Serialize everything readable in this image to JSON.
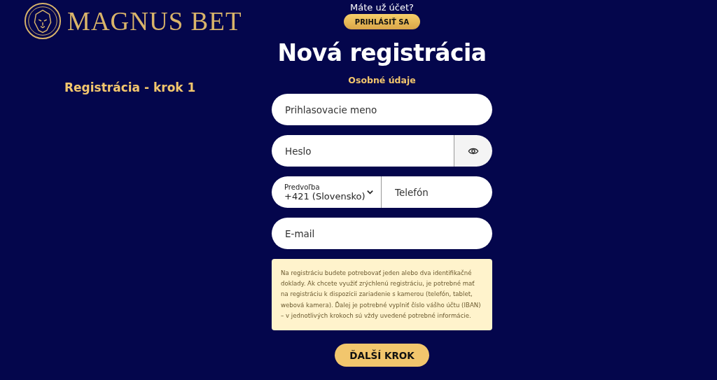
{
  "logo": {
    "text": "MAGNUS BET"
  },
  "step_label": "Registrácia - krok 1",
  "login_prompt": {
    "text": "Máte už účet?",
    "button": "PRIHLÁSIŤ SA"
  },
  "title": "Nová registrácia",
  "section": "Osobné údaje",
  "fields": [
    {
      "kind": "text",
      "placeholder": "Prihlasovacie meno"
    },
    {
      "kind": "password",
      "placeholder": "Heslo"
    },
    {
      "kind": "phone",
      "prefix_label": "Predvoľba",
      "prefix_value": "+421 (Slovensko)",
      "placeholder": "Telefón"
    },
    {
      "kind": "text",
      "placeholder": "E-mail"
    }
  ],
  "info": "Na registráciu budete potrebovať jeden alebo dva identifikačné doklady. Ak chcete využiť zrýchlenú registráciu, je potrebné mať na registráciu k dispozícii zariadenie s kamerou (telefón, tablet, webová kamera). Ďalej je potrebné vyplniť číslo vášho účtu (IBAN) – v jednotlivých krokoch sú vždy uvedené potrebné informácie.",
  "next_button": "ĎALŠÍ KROK"
}
